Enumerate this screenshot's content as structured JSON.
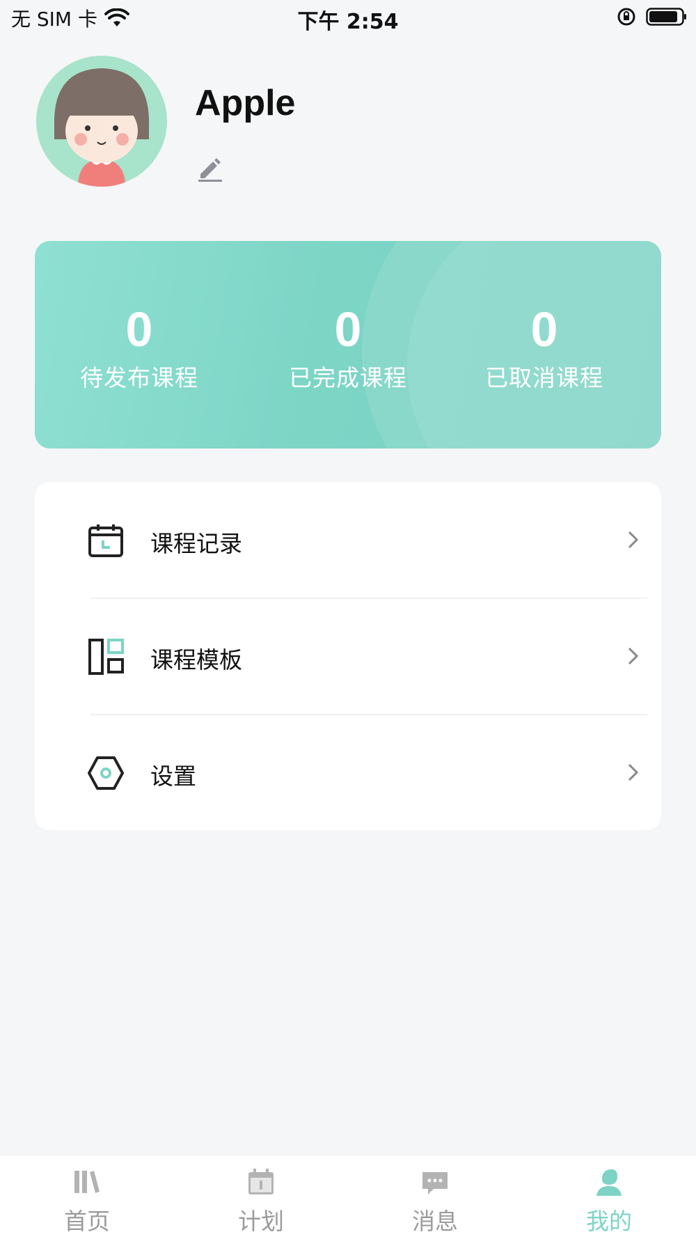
{
  "status_bar": {
    "carrier": "无 SIM 卡",
    "time": "下午 2:54"
  },
  "profile": {
    "username": "Apple",
    "avatar_icon": "girl-avatar-icon",
    "edit_icon": "pencil-icon"
  },
  "stats": [
    {
      "value": "0",
      "label": "待发布课程"
    },
    {
      "value": "0",
      "label": "已完成课程"
    },
    {
      "value": "0",
      "label": "已取消课程"
    }
  ],
  "menu": [
    {
      "label": "课程记录",
      "icon": "calendar-icon"
    },
    {
      "label": "课程模板",
      "icon": "template-icon"
    },
    {
      "label": "设置",
      "icon": "hexagon-settings-icon"
    }
  ],
  "tabbar": [
    {
      "label": "首页",
      "icon": "books-icon",
      "active": false
    },
    {
      "label": "计划",
      "icon": "calendar-day-icon",
      "active": false
    },
    {
      "label": "消息",
      "icon": "chat-bubble-icon",
      "active": false
    },
    {
      "label": "我的",
      "icon": "person-icon",
      "active": true
    }
  ],
  "colors": {
    "accent": "#7dd4c5",
    "background": "#f5f6f8",
    "tab_inactive": "#9b9b9b"
  }
}
